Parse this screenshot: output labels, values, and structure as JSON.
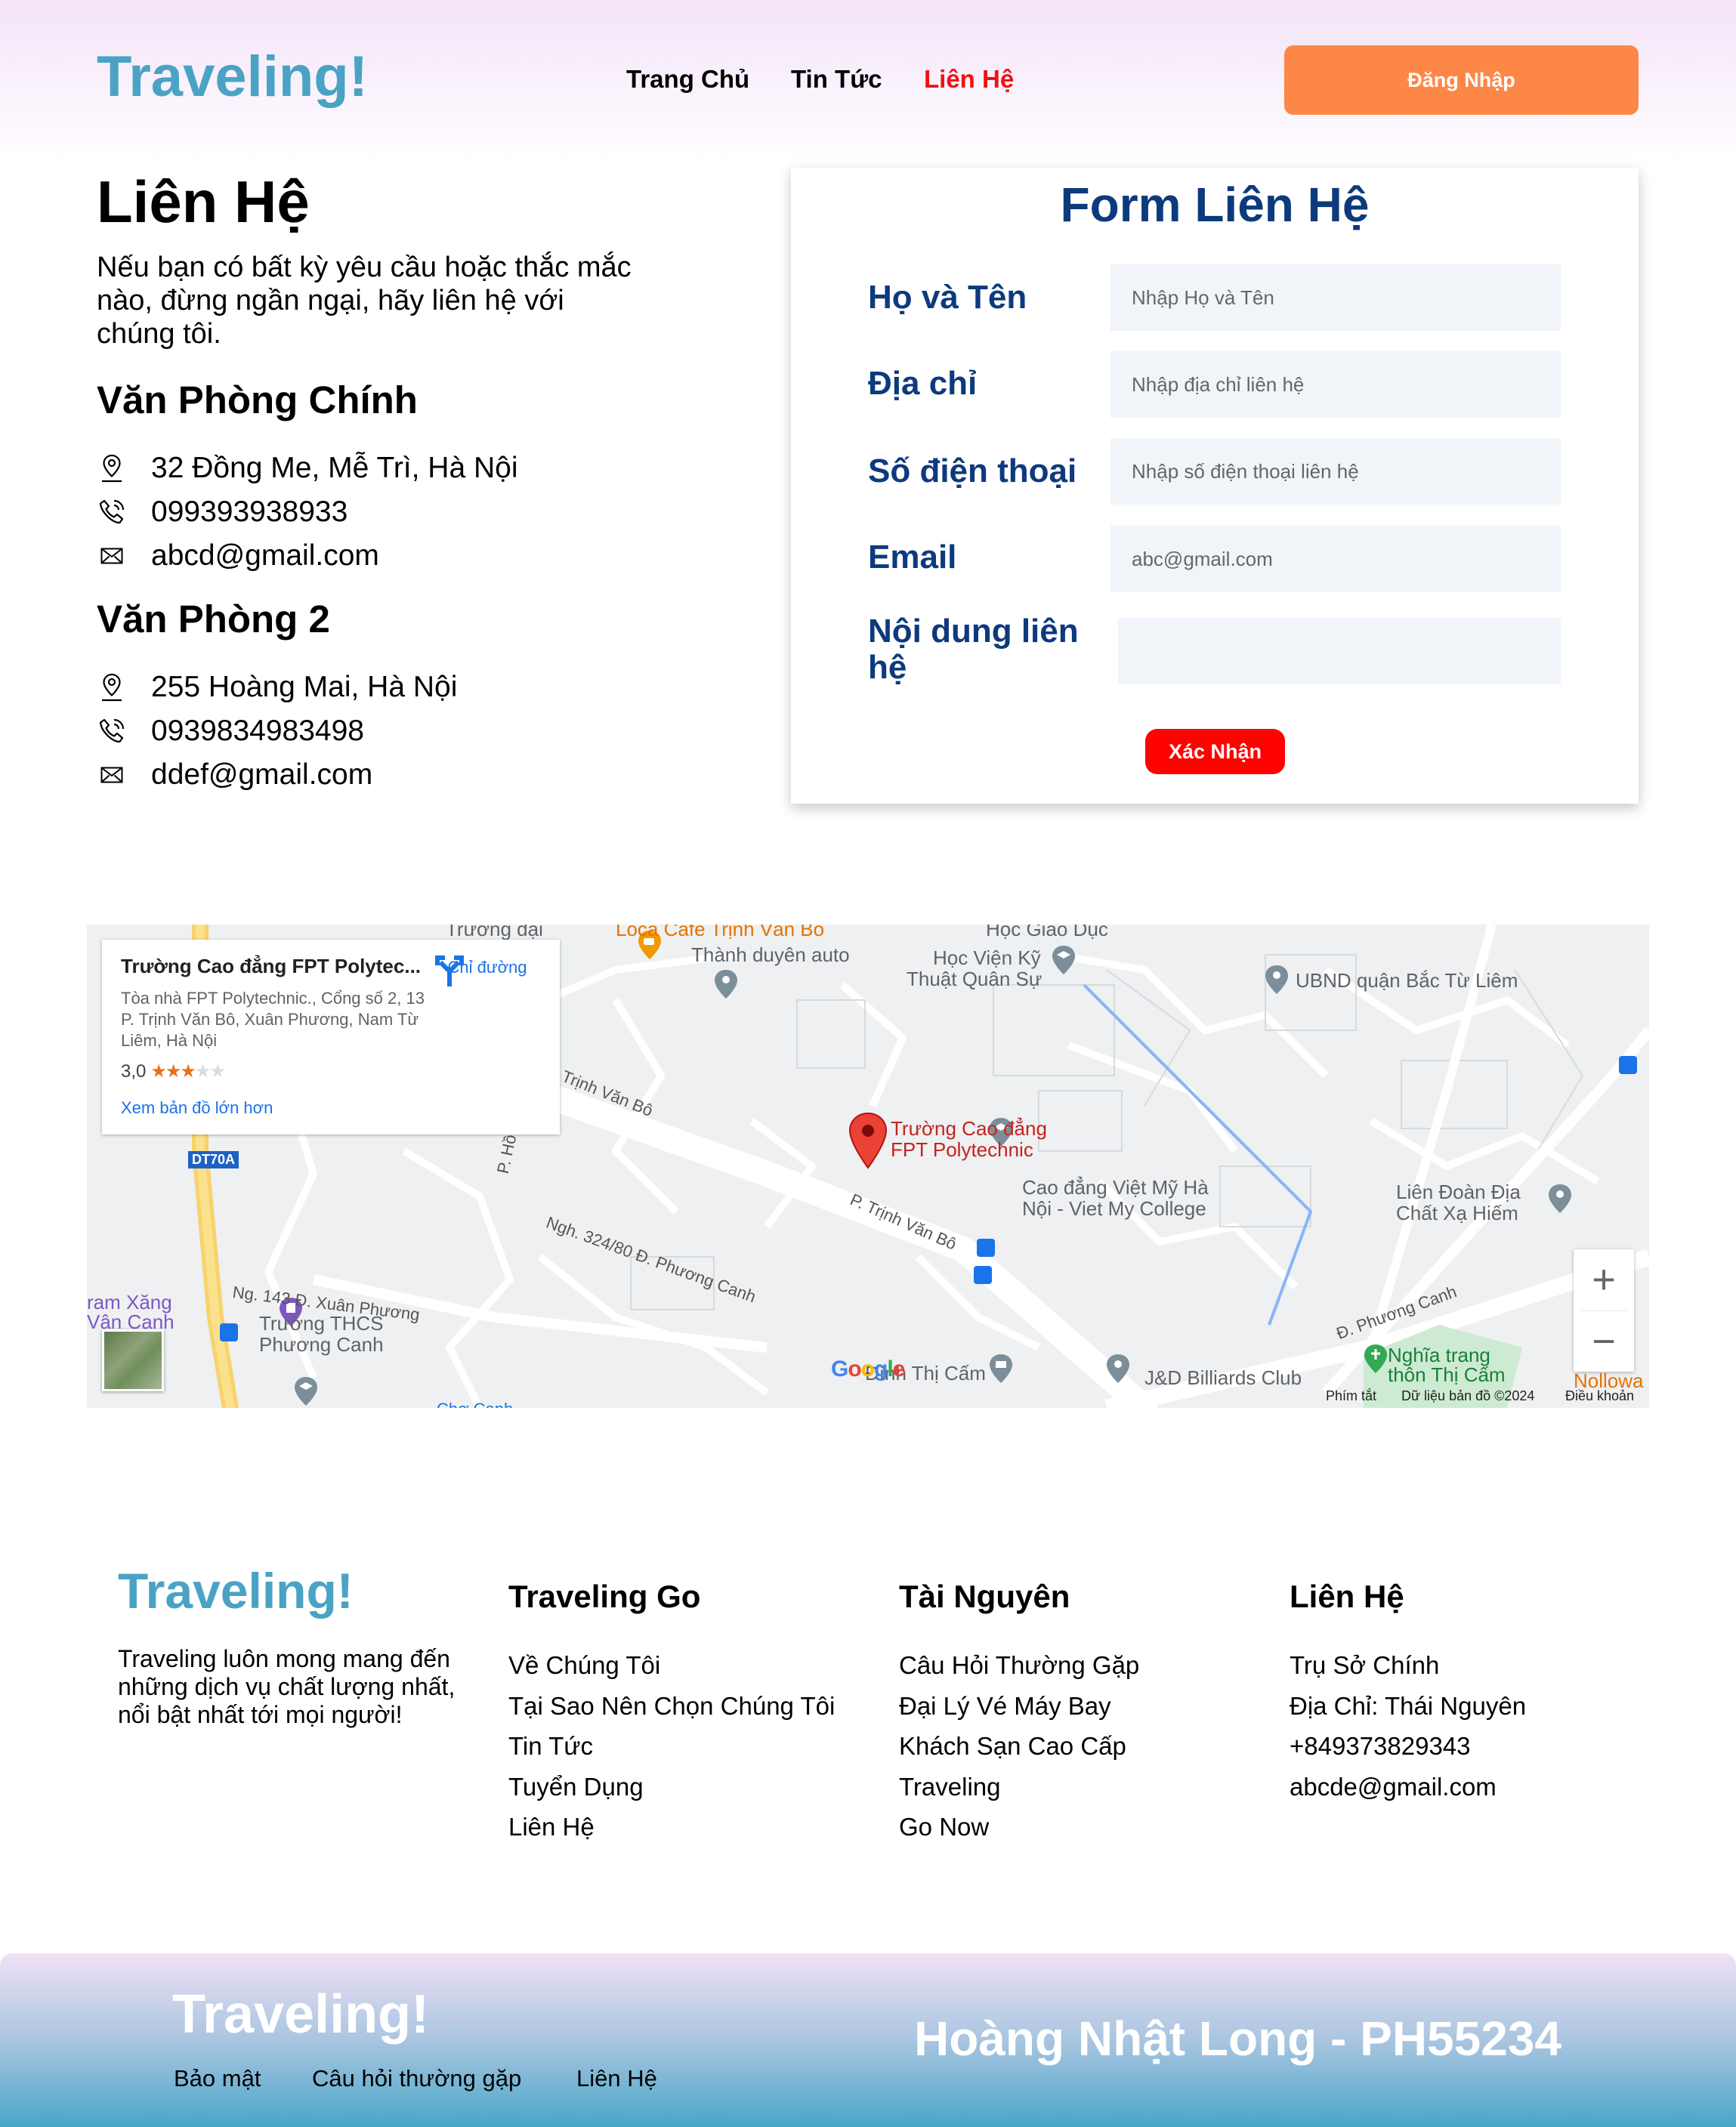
{
  "header": {
    "logo": "Traveling!",
    "nav": [
      "Trang Chủ",
      "Tin Tức",
      "Liên Hệ"
    ],
    "login_label": "Đăng Nhập"
  },
  "contact": {
    "title": "Liên Hệ",
    "intro": "Nếu bạn có bất kỳ yêu cầu hoặc thắc mắc nào, đừng ngần ngại, hãy liên hệ với chúng tôi.",
    "offices": [
      {
        "title": "Văn Phòng Chính",
        "address": "32 Đồng Me, Mễ Trì, Hà Nội",
        "phone": "099393938933",
        "email": "abcd@gmail.com"
      },
      {
        "title": "Văn Phòng 2",
        "address": "255 Hoàng Mai, Hà Nội",
        "phone": "0939834983498",
        "email": "ddef@gmail.com"
      }
    ],
    "icons": {
      "address": "location-pin-icon",
      "phone": "phone-icon",
      "email": "envelope-icon"
    }
  },
  "form": {
    "title": "Form Liên Hệ",
    "name_label": "Họ và Tên",
    "name_placeholder": "Nhập Họ và Tên",
    "address_label": "Địa chỉ",
    "address_placeholder": "Nhập địa chỉ liên hệ",
    "phone_label": "Số điện thoại",
    "phone_placeholder": "Nhập số điện thoại liên hệ",
    "email_label": "Email",
    "email_placeholder": "abc@gmail.com",
    "message_label": "Nội dung liên hệ",
    "submit_label": "Xác Nhận"
  },
  "map": {
    "place_title": "Trường Cao đẳng FPT Polytec...",
    "place_address": "Tòa nhà FPT Polytechnic., Cổng số 2, 13 P. Trịnh Văn Bô, Xuân Phương, Nam Từ Liêm, Hà Nội",
    "rating": "3,0",
    "stars_filled": 3,
    "stars_total": 5,
    "larger_map_link": "Xem bản đồ lớn hơn",
    "directions_label": "Chỉ đường",
    "marker_label_1": "Trường Cao đẳng",
    "marker_label_2": "FPT Polytechnic",
    "labels": {
      "truong_dai": "Trường đại",
      "cafe": "Loca Cafe Trịnh Văn Bô",
      "thanh_duyen": "Thành duyên auto",
      "hoc_giao_duc": "Học Giáo Dục",
      "hoc_vien_1": "Học Viện Kỹ",
      "hoc_vien_2": "Thuật Quân Sự",
      "ubnd": "UBND quận Bắc Từ Liêm",
      "trinh_van_bo": "Trịnh Văn Bô",
      "p_trinh_van_bo": "P. Trịnh Văn Bô",
      "p_ho": "P. Hồ",
      "dt70a": "DT70A",
      "viet_my_1": "Cao đẳng Việt Mỹ Hà",
      "viet_my_2": "Nội - Viet My College",
      "lien_doan_1": "Liên Đoàn Địa",
      "lien_doan_2": "Chất Xạ Hiếm",
      "ngh_324": "Ngh. 324/80 Đ. Phương Canh",
      "ng_143": "Ng. 143 Đ. Xuân Phương",
      "tram_xang_1": "ram Xăng",
      "tram_xang_2": "Vân Canh",
      "thcs_1": "Trường THCS",
      "thcs_2": "Phương Canh",
      "thi_cam": "Đình Thị Cấm",
      "billiards": "J&D Billiards Club",
      "phuong_canh": "Đ. Phương Canh",
      "nghia_trang_1": "Nghĩa trang",
      "nghia_trang_2": "thôn Thị Cấm",
      "nollowa": "Nollowa",
      "cho_canh": "Chợ Canh",
      "google": "Google"
    },
    "attribution": [
      "Phím tắt",
      "Dữ liệu bản đồ ©2024",
      "Điều khoản"
    ]
  },
  "footer": {
    "logo": "Traveling!",
    "desc": "Traveling luôn mong mang đến những dịch vụ chất lượng nhất, nổi bật nhất tới mọi người!",
    "columns": [
      {
        "title": "Traveling Go",
        "items": [
          "Về Chúng Tôi",
          "Tại Sao Nên Chọn Chúng Tôi",
          "Tin Tức",
          "Tuyển Dụng",
          "Liên Hệ"
        ]
      },
      {
        "title": "Tài Nguyên",
        "items": [
          "Câu Hỏi Thường Gặp",
          "Đại Lý Vé Máy Bay",
          "Khách Sạn Cao Cấp",
          "Traveling",
          "Go Now"
        ]
      },
      {
        "title": "Liên Hệ",
        "items": [
          "Trụ Sở Chính",
          "Địa Chỉ: Thái Nguyên",
          "+849373829343",
          "abcde@gmail.com"
        ]
      }
    ]
  },
  "bottom": {
    "logo": "Traveling!",
    "links": [
      "Bảo mật",
      "Câu hỏi thường gặp",
      "Liên Hệ"
    ],
    "author": "Hoàng Nhật Long - PH55234"
  }
}
